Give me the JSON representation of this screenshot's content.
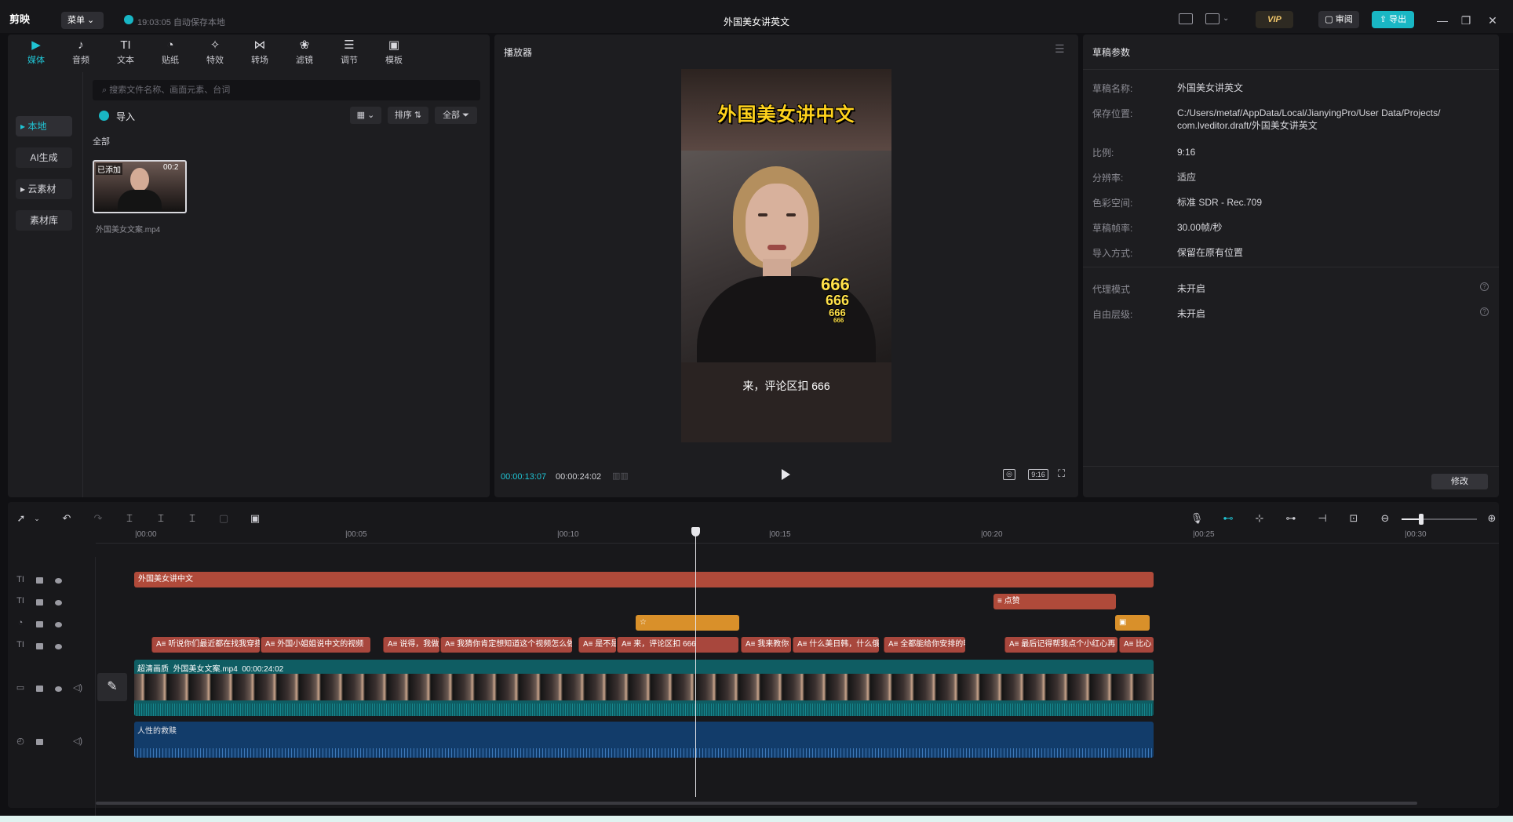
{
  "app": {
    "logo_text": "剪映",
    "menu_label": "菜单",
    "autosave_text": "19:03:05 自动保存本地",
    "window_title": "外国美女讲英文",
    "vip_label": "VIP",
    "review_label": "审阅",
    "export_label": "导出",
    "colors": {
      "accent": "#20c4d4",
      "title_clip": "#b04a3a",
      "sticker_clip": "#d9902a",
      "video_track": "#0f5d63",
      "audio_track": "#123c6a"
    }
  },
  "media": {
    "tabs": [
      {
        "label": "媒体",
        "icon": "media-icon",
        "glyph": "▶"
      },
      {
        "label": "音频",
        "icon": "audio-icon",
        "glyph": "♪"
      },
      {
        "label": "文本",
        "icon": "text-icon",
        "glyph": "TI"
      },
      {
        "label": "贴纸",
        "icon": "sticker-icon",
        "glyph": "◔"
      },
      {
        "label": "特效",
        "icon": "effects-icon",
        "glyph": "✧"
      },
      {
        "label": "转场",
        "icon": "transition-icon",
        "glyph": "⋈"
      },
      {
        "label": "滤镜",
        "icon": "filter-icon",
        "glyph": "❀"
      },
      {
        "label": "调节",
        "icon": "adjust-icon",
        "glyph": "☰"
      },
      {
        "label": "模板",
        "icon": "template-icon",
        "glyph": "▣"
      }
    ],
    "side": [
      "本地",
      "AI生成",
      "云素材",
      "素材库"
    ],
    "search_placeholder": "搜索文件名称、画面元素、台词",
    "import_label": "导入",
    "sort_label": "排序",
    "filter_label": "全部",
    "section_label": "全部",
    "item": {
      "badge": "已添加",
      "duration": "00:2",
      "name": "外国美女文案.mp4"
    }
  },
  "player": {
    "title": "播放器",
    "video_title": "外国美女讲中文",
    "subtitle": "来，评论区扣 666",
    "sticker_text": [
      "666",
      "666",
      "666",
      "666"
    ],
    "current_time": "00:00:13:07",
    "total_time": "00:00:24:02",
    "ratio": "9:16"
  },
  "props": {
    "title": "草稿参数",
    "rows": [
      {
        "key": "草稿名称:",
        "value": "外国美女讲英文"
      },
      {
        "key": "保存位置:",
        "value": "C:/Users/metaf/AppData/Local/JianyingPro/User Data/Projects/",
        "value2": "com.lveditor.draft/外国美女讲英文"
      },
      {
        "key": "比例:",
        "value": "9:16"
      },
      {
        "key": "分辨率:",
        "value": "适应"
      },
      {
        "key": "色彩空间:",
        "value": "标准 SDR - Rec.709"
      },
      {
        "key": "草稿帧率:",
        "value": "30.00帧/秒"
      },
      {
        "key": "导入方式:",
        "value": "保留在原有位置"
      },
      {
        "key": "代理模式",
        "value": "未开启"
      },
      {
        "key": "自由层级:",
        "value": "未开启"
      }
    ],
    "modify_label": "修改"
  },
  "timeline": {
    "ruler": [
      "|00:00",
      "|00:05",
      "|00:10",
      "|00:15",
      "|00:20",
      "|00:25",
      "|00:30"
    ],
    "title_clip": "外国美女讲中文",
    "like_clip": "点赞",
    "text_clips": [
      "A≡ 听说你们最近都在找我穿搭",
      "A≡ 外国小姐姐说中文的视频",
      "A≡ 说得，我做",
      "A≡ 我猜你肯定想知道这个视频怎么做",
      "A≡ 是不是",
      "A≡ 来，评论区扣 666",
      "A≡ 我来教你",
      "A≡ 什么美日韩，什么俄",
      "A≡ 全都能给你安排的明明白白",
      "A≡ 最后记得帮我点个小红心再",
      "A≡ 比心"
    ],
    "video_clip": {
      "quality": "超清画质",
      "name": "外国美女文案.mp4",
      "duration": "00:00:24:02"
    },
    "audio_clip": "人性的救赎"
  }
}
